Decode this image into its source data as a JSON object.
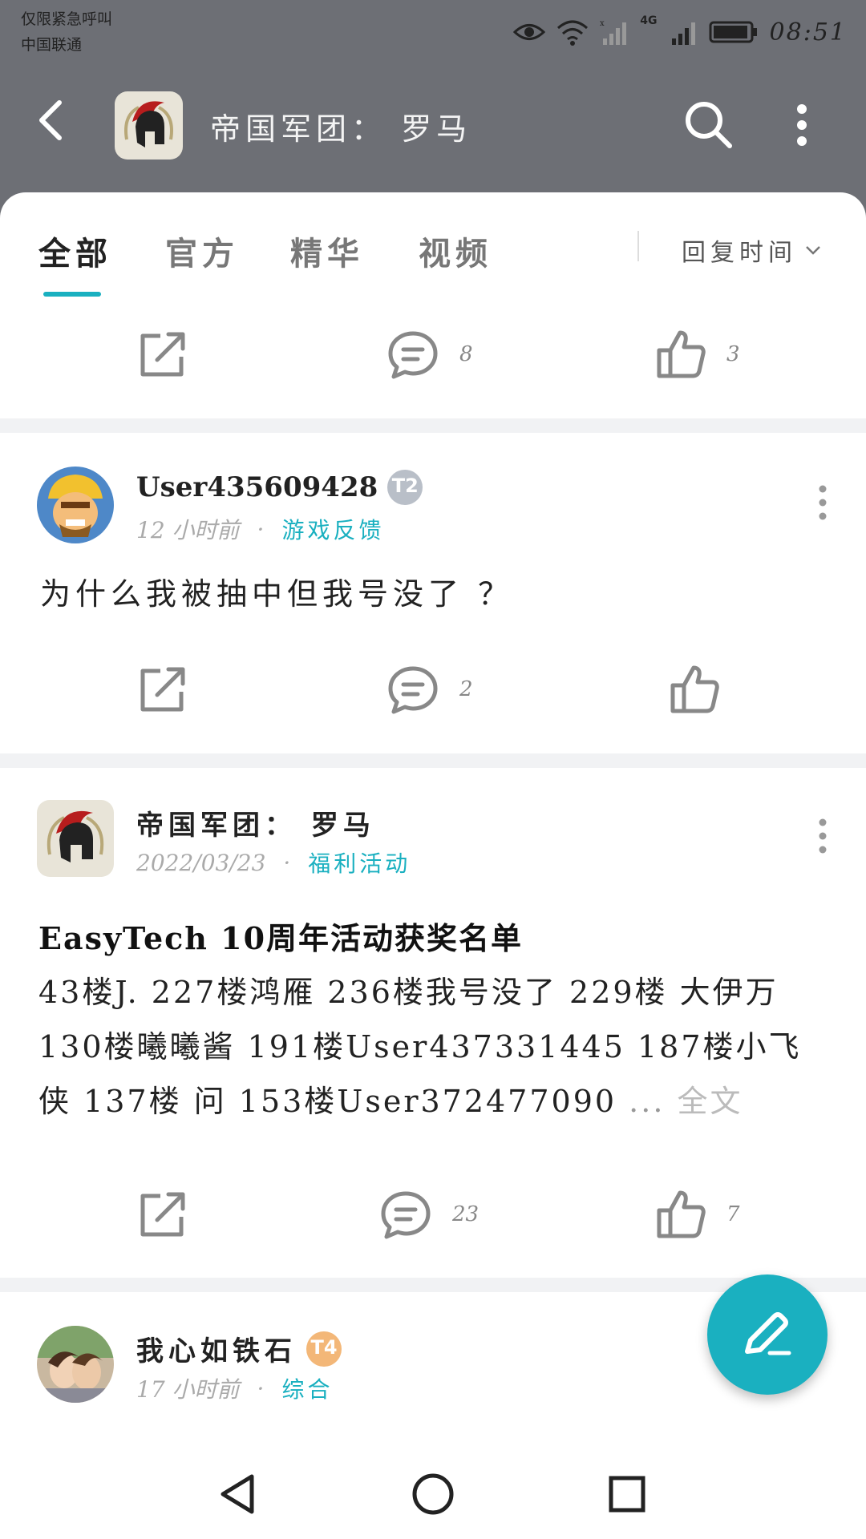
{
  "status_bar": {
    "carrier_line1": "仅限紧急呼叫",
    "carrier_line2": "中国联通",
    "network_label": "4G",
    "time": "08:51"
  },
  "header": {
    "title": "帝国军团： 罗马"
  },
  "tabs": [
    {
      "label": "全部",
      "active": true
    },
    {
      "label": "官方",
      "active": false
    },
    {
      "label": "精华",
      "active": false
    },
    {
      "label": "视频",
      "active": false
    }
  ],
  "sort_label": "回复时间",
  "colors": {
    "accent": "#1ab0c0",
    "header_bg": "#6d6f75"
  },
  "top_partial_post": {
    "comments": "8",
    "likes": "3"
  },
  "posts": [
    {
      "author": "User435609428",
      "level": "T2",
      "time": "12 小时前",
      "category": "游戏反馈",
      "text": "为什么我被抽中但我号没了 ？",
      "comments": "2",
      "likes": ""
    },
    {
      "author": "帝国军团： 罗马",
      "time": "2022/03/23",
      "category": "福利活动",
      "title": "EasyTech 10周年活动获奖名单",
      "body": "43楼J. 227楼鸿雁 236楼我号没了 229楼 大伊万 130楼曦曦酱 191楼User437331445 187楼小飞侠 137楼 问 153楼User372477090",
      "ellipsis": "...",
      "full_text_label": "全文",
      "comments": "23",
      "likes": "7"
    },
    {
      "author": "我心如铁石",
      "level": "T4",
      "time": "17 小时前",
      "category": "综合"
    }
  ],
  "icons": [
    "back-icon",
    "search-icon",
    "more-icon",
    "share-icon",
    "comment-icon",
    "like-icon",
    "edit-icon",
    "nav-back-icon",
    "nav-home-icon",
    "nav-recents-icon"
  ]
}
